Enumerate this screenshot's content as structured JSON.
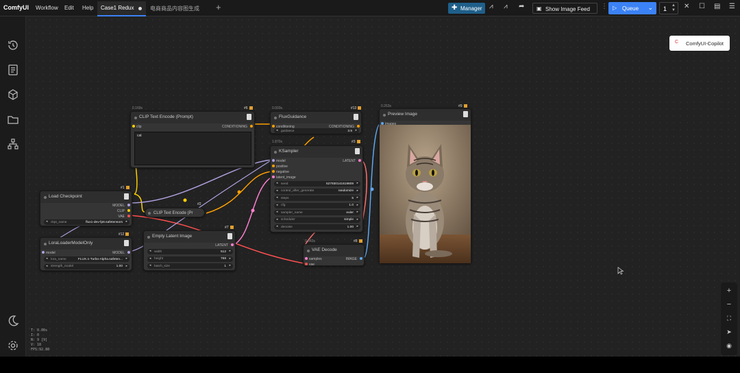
{
  "menubar": {
    "app_name": "ComfyUI",
    "menus": [
      "Workflow",
      "Edit",
      "Help"
    ],
    "tabs": [
      {
        "label": "Case1 Redux",
        "active": true,
        "unsaved": true
      },
      {
        "label": "电商商品内容图生成",
        "active": false
      }
    ],
    "new_tab": "+",
    "manager_label": "Manager",
    "show_feed_label": "Show Image Feed",
    "queue_label": "Queue",
    "queue_count": "1"
  },
  "copilot": {
    "label": "ComfyUI-Copilot"
  },
  "colors": {
    "accent": "#3b82f6",
    "manager": "#1f5f8a",
    "badge": "#e0a030"
  },
  "nodes": {
    "clip_text_encode_1": {
      "time": "0.169s",
      "title": "CLIP Text Encode (Prompt)",
      "id": "#6",
      "in_clip": "clip",
      "out": "CONDITIONING",
      "text": "cat"
    },
    "flux_guidance": {
      "time": "0.003s",
      "title": "FluxGuidance",
      "id": "#13",
      "in": "conditioning",
      "out": "CONDITIONING",
      "guidance_label": "guidance",
      "guidance_value": "3.5"
    },
    "preview_image": {
      "time": "0.263s",
      "title": "Preview Image",
      "id": "#9",
      "in": "images"
    },
    "ksampler": {
      "time": "1.870s",
      "title": "KSampler",
      "id": "#3",
      "inputs": [
        "model",
        "positive",
        "negative",
        "latent_image"
      ],
      "out": "LATENT",
      "widgets": [
        {
          "label": "seed",
          "value": "527930141619609"
        },
        {
          "label": "control_after_generate",
          "value": "randomize"
        },
        {
          "label": "steps",
          "value": "5"
        },
        {
          "label": "cfg",
          "value": "1.0"
        },
        {
          "label": "sampler_name",
          "value": "euler"
        },
        {
          "label": "scheduler",
          "value": "simple"
        },
        {
          "label": "denoise",
          "value": "1.00"
        }
      ]
    },
    "load_checkpoint": {
      "title": "Load Checkpoint",
      "id": "#1",
      "outs": [
        "MODEL",
        "CLIP",
        "VAE"
      ],
      "ckpt_label": "ckpt_name",
      "ckpt_value": "flux1-dev-fp8.safetensors"
    },
    "clip_text_encode_2": {
      "title": "CLIP Text Encode (Pr",
      "id": "#2"
    },
    "lora_loader": {
      "title": "LoraLoaderModelOnly",
      "id": "#12",
      "in": "model",
      "out": "MODEL",
      "widgets": [
        {
          "label": "lora_name",
          "value": "FLUX.1-Turbo-Alpha.safeten..."
        },
        {
          "label": "strength_model",
          "value": "1.00"
        }
      ]
    },
    "empty_latent": {
      "title": "Empty Latent Image",
      "id": "#7",
      "out": "LATENT",
      "widgets": [
        {
          "label": "width",
          "value": "512"
        },
        {
          "label": "height",
          "value": "768"
        },
        {
          "label": "batch_size",
          "value": "1"
        }
      ]
    },
    "vae_decode": {
      "time": "0.043s",
      "title": "VAE Decode",
      "id": "#8",
      "ins": [
        "samples",
        "vae"
      ],
      "out": "IMAGE"
    }
  },
  "stats": [
    "T: 0.00s",
    "I: 0",
    "N: 9 [9]",
    "V: 18",
    "FPS:92.88"
  ]
}
